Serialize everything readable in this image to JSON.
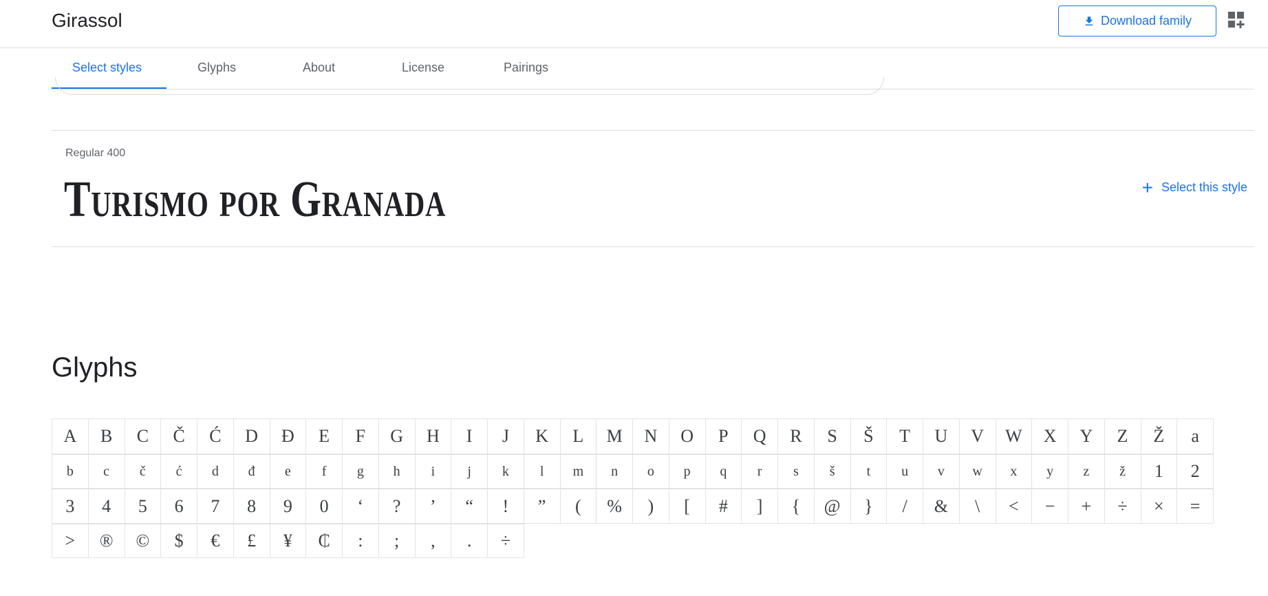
{
  "header": {
    "family_name": "Girassol",
    "download_label": "Download family"
  },
  "tabs": [
    {
      "label": "Select styles",
      "active": true
    },
    {
      "label": "Glyphs",
      "active": false
    },
    {
      "label": "About",
      "active": false
    },
    {
      "label": "License",
      "active": false
    },
    {
      "label": "Pairings",
      "active": false
    }
  ],
  "style": {
    "label": "Regular 400",
    "specimen": "Turismo por Granada",
    "select_label": "Select this style"
  },
  "glyphs": {
    "heading": "Glyphs",
    "rows": [
      [
        "A",
        "B",
        "C",
        "Č",
        "Ć",
        "D",
        "Đ",
        "E",
        "F",
        "G",
        "H",
        "I",
        "J",
        "K",
        "L",
        "M",
        "N",
        "O",
        "P",
        "Q",
        "R",
        "S",
        "Š",
        "T",
        "U",
        "V",
        "W",
        "X",
        "Y",
        "Z",
        "Ž",
        "a"
      ],
      [
        "b",
        "c",
        "č",
        "ć",
        "d",
        "đ",
        "e",
        "f",
        "g",
        "h",
        "i",
        "j",
        "k",
        "l",
        "m",
        "n",
        "o",
        "p",
        "q",
        "r",
        "s",
        "š",
        "t",
        "u",
        "v",
        "w",
        "x",
        "y",
        "z",
        "ž",
        "1",
        "2"
      ],
      [
        "3",
        "4",
        "5",
        "6",
        "7",
        "8",
        "9",
        "0",
        "‘",
        "?",
        "’",
        "“",
        "!",
        "”",
        "(",
        "%",
        ")",
        "[",
        "#",
        "]",
        "{",
        "@",
        "}",
        "/",
        "&",
        "\\",
        "<",
        "−",
        "+",
        "÷",
        "×",
        "="
      ],
      [
        ">",
        "®",
        "©",
        "$",
        "€",
        "£",
        "¥",
        "₵",
        ":",
        ";",
        ",",
        ".",
        "÷"
      ]
    ]
  },
  "colors": {
    "accent": "#1a73e8",
    "text": "#202124",
    "muted": "#5f6368",
    "border": "#dadce0"
  }
}
